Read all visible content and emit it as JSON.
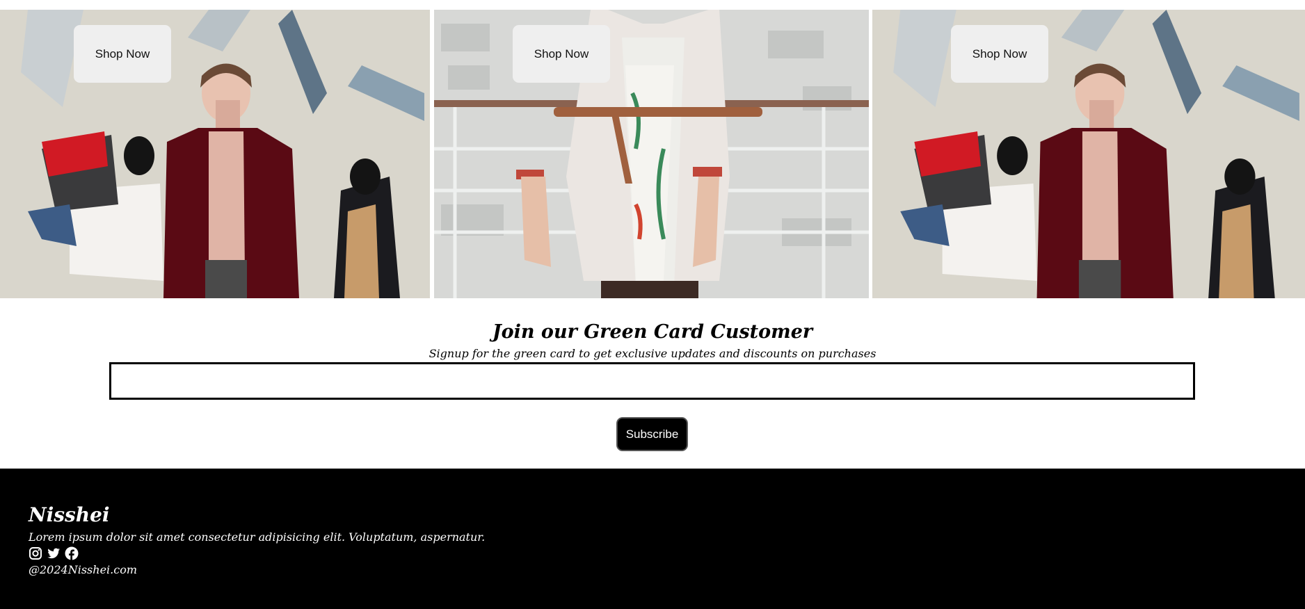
{
  "hero": {
    "cards": [
      {
        "button_label": "Shop Now",
        "image": "woman-shopping-bags-photo"
      },
      {
        "button_label": "Shop Now",
        "image": "white-belted-coat-photo"
      },
      {
        "button_label": "Shop Now",
        "image": "woman-shopping-bags-photo"
      }
    ]
  },
  "signup": {
    "title": "Join our Green Card Customer",
    "subtitle": "Signup for the green card to get exclusive updates and discounts on purchases",
    "input_value": "",
    "button_label": "Subscribe"
  },
  "footer": {
    "brand": "Nisshei",
    "description": "Lorem ipsum dolor sit amet consectetur adipisicing elit. Voluptatum, aspernatur.",
    "social_icons": [
      "instagram-icon",
      "twitter-icon",
      "facebook-icon"
    ],
    "copyright": "@2024Nisshei.com"
  },
  "colors": {
    "footer_bg": "#000000",
    "shop_button_bg": "#efefef",
    "subscribe_bg": "#000000"
  }
}
